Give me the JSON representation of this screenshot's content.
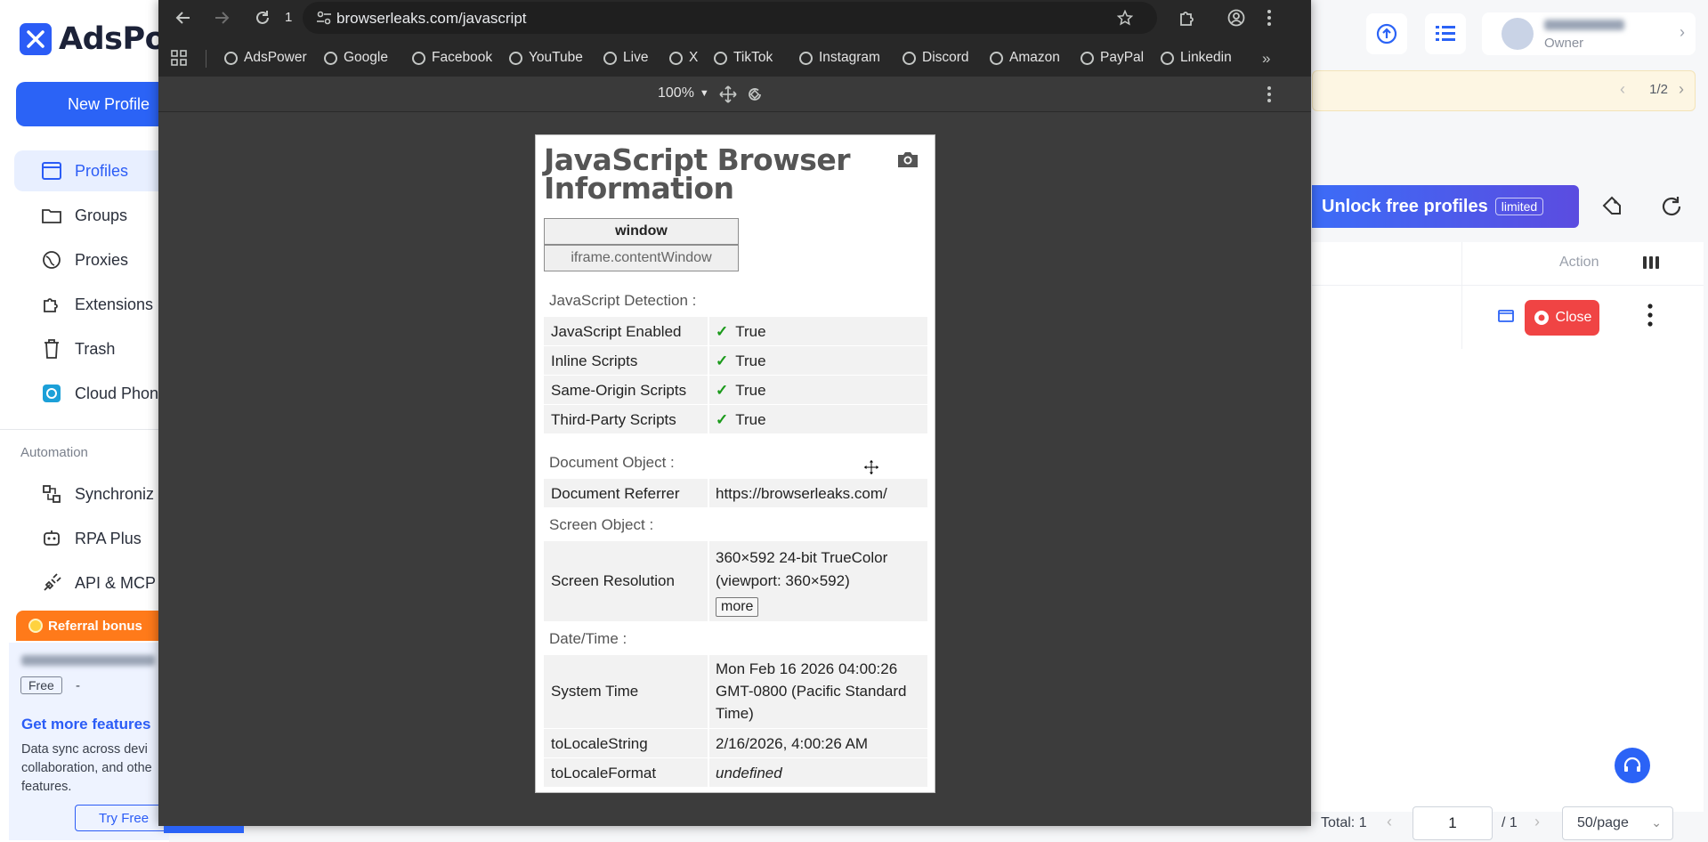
{
  "app": {
    "logo_text": "AdsPo",
    "new_profile_label": "New Profile",
    "nav": [
      {
        "label": "Profiles",
        "icon": "browser-icon"
      },
      {
        "label": "Groups",
        "icon": "folder-icon"
      },
      {
        "label": "Proxies",
        "icon": "globe-icon"
      },
      {
        "label": "Extensions",
        "icon": "puzzle-icon"
      },
      {
        "label": "Trash",
        "icon": "trash-icon"
      },
      {
        "label": "Cloud Phon",
        "icon": "cloud-phone-icon"
      }
    ],
    "automation_label": "Automation",
    "automation_nav": [
      {
        "label": "Synchroniz",
        "icon": "sync-icon"
      },
      {
        "label": "RPA Plus",
        "icon": "robot-icon"
      },
      {
        "label": "API & MCP",
        "icon": "plug-icon"
      }
    ],
    "referral_label": "Referral bonus",
    "plan": {
      "free_tag": "Free",
      "free_dash": "-",
      "get_more": "Get more features",
      "desc": "Data sync across devi collaboration, and othe features.",
      "try_free": "Try Free"
    },
    "owner_role": "Owner",
    "notice_page": "1/2",
    "unlock_label": "Unlock free profiles",
    "limited_tag": "limited",
    "action_header": "Action",
    "close_label": "Close",
    "pager": {
      "total": "Total: 1",
      "page": "1",
      "of": "/ 1",
      "page_size": "50/page"
    }
  },
  "browser": {
    "tab_count": "1",
    "url": "browserleaks.com/javascript",
    "bookmarks": [
      "AdsPower",
      "Google",
      "Facebook",
      "YouTube",
      "Live",
      "X",
      "TikTok",
      "Instagram",
      "Discord",
      "Amazon",
      "PayPal",
      "Linkedin"
    ],
    "zoom": "100%"
  },
  "page": {
    "title": "JavaScript Browser Information",
    "tabs": [
      "window",
      "iframe.contentWindow"
    ],
    "js_detection_label": "JavaScript Detection :",
    "js_rows": [
      {
        "k": "JavaScript Enabled",
        "v": "True"
      },
      {
        "k": "Inline Scripts",
        "v": "True"
      },
      {
        "k": "Same-Origin Scripts",
        "v": "True"
      },
      {
        "k": "Third-Party Scripts",
        "v": "True"
      }
    ],
    "document_label": "Document Object :",
    "doc_referrer_k": "Document Referrer",
    "doc_referrer_v": "https://browserleaks.com/",
    "screen_label": "Screen Object :",
    "screen_res_k": "Screen Resolution",
    "screen_res_v": "360×592 24-bit TrueColor (viewport: 360×592)",
    "more_label": "more",
    "datetime_label": "Date/Time :",
    "system_time_k": "System Time",
    "system_time_v": "Mon Feb 16 2026 04:00:26 GMT-0800 (Pacific Standard Time)",
    "locale_string_k": "toLocaleString",
    "locale_string_v": "2/16/2026, 4:00:26 AM",
    "locale_format_k": "toLocaleFormat",
    "locale_format_v": "undefined"
  },
  "colors": {
    "accent": "#2b63f6",
    "close_red": "#f04444",
    "referral_orange": "#ff7a1a",
    "check_green": "#1a9a1a"
  }
}
